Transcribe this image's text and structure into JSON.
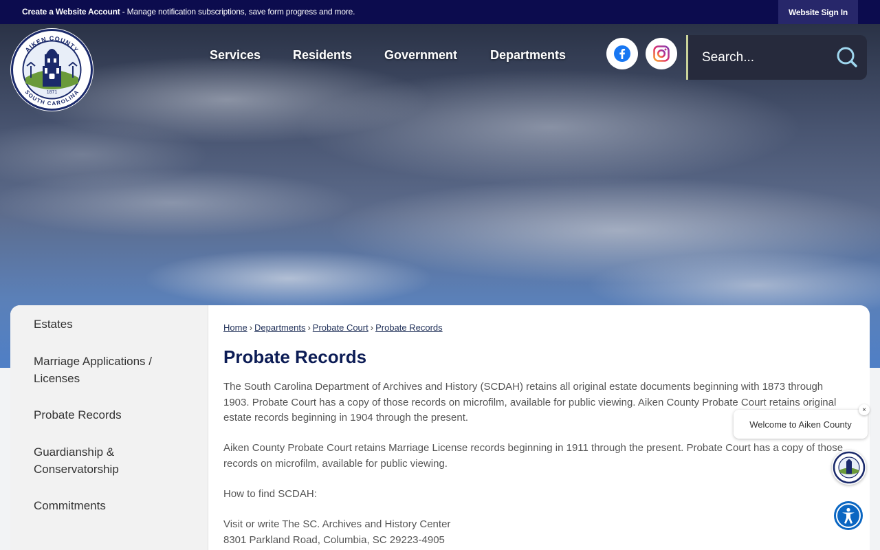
{
  "topbar": {
    "account_link": "Create a Website Account",
    "account_text": " - Manage notification subscriptions, save form progress and more.",
    "sign_in": "Website Sign In"
  },
  "logo": {
    "top_text": "AIKEN COUNTY",
    "bottom_text": "SOUTH CAROLINA",
    "year": "1871"
  },
  "nav": {
    "items": [
      "Services",
      "Residents",
      "Government",
      "Departments"
    ]
  },
  "social": {
    "facebook": "facebook-icon",
    "instagram": "instagram-icon"
  },
  "search": {
    "placeholder": "Search..."
  },
  "sidebar": {
    "items": [
      {
        "label": "Estates"
      },
      {
        "label": "Marriage Applications / Licenses"
      },
      {
        "label": "Probate Records"
      },
      {
        "label": "Guardianship & Conservatorship"
      },
      {
        "label": "Commitments"
      }
    ]
  },
  "breadcrumb": {
    "items": [
      "Home",
      "Departments",
      "Probate Court",
      "Probate Records"
    ],
    "separator": "›"
  },
  "page": {
    "title": "Probate Records",
    "paragraphs": [
      "The South Carolina Department of Archives and History (SCDAH) retains all original estate documents beginning with 1873 through 1903. Probate Court has a copy of those records on microfilm, available for public viewing. Aiken County Probate Court retains original estate records beginning in 1904 through the present.",
      "Aiken County Probate Court retains Marriage License records beginning in 1911 through the present. Probate Court has a copy of those records on microfilm, available for public viewing.",
      "How to find SCDAH:",
      "Visit or write The SC. Archives and History Center",
      "8301 Parkland Road, Columbia, SC 29223-4905"
    ]
  },
  "chat": {
    "welcome": "Welcome to Aiken County",
    "close": "×"
  },
  "colors": {
    "topbar": "#0c0c4e",
    "title": "#0c1c55",
    "accessibility": "#0a66c2"
  }
}
